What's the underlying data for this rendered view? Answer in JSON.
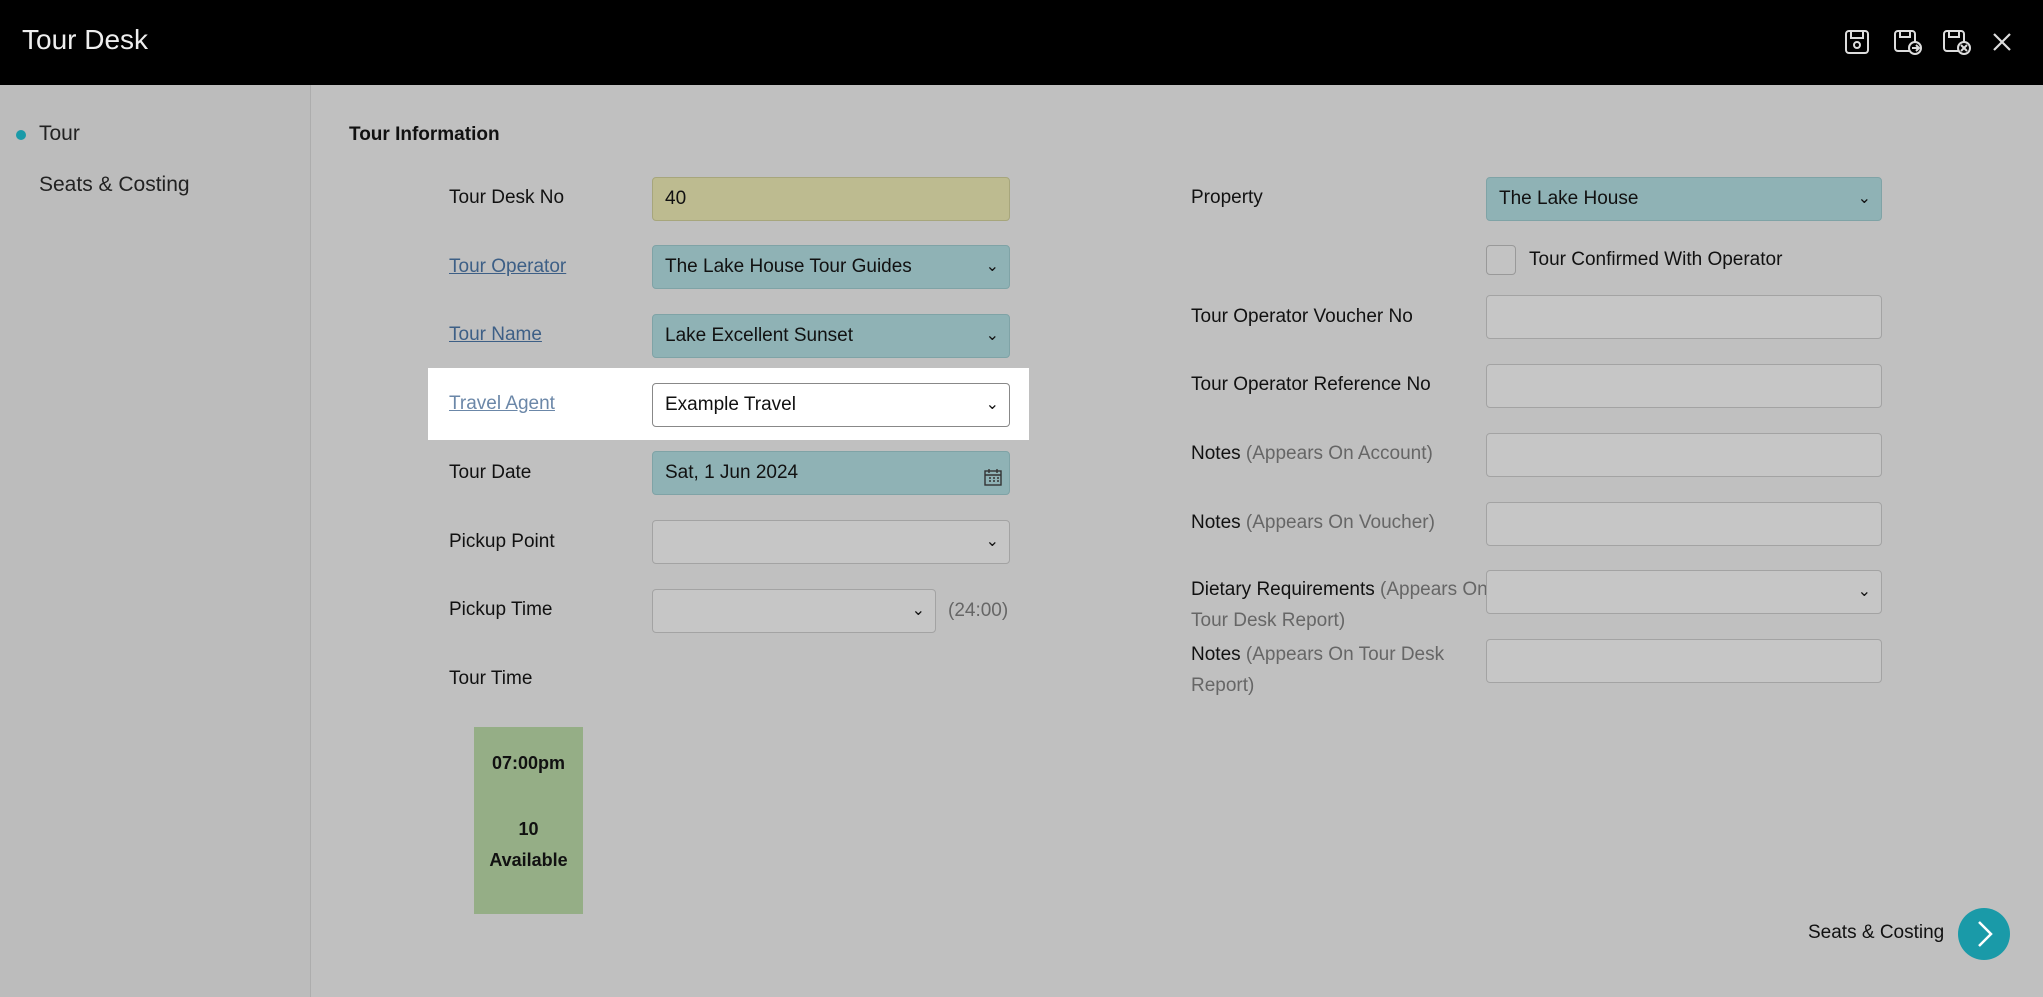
{
  "app": {
    "title": "Tour Desk"
  },
  "toolbar": {
    "icons": [
      "save-icon",
      "save-and-new-icon",
      "save-and-close-icon",
      "close-icon"
    ]
  },
  "sidebar": {
    "items": [
      {
        "label": "Tour",
        "active": true
      },
      {
        "label": "Seats & Costing",
        "active": false
      }
    ]
  },
  "section": {
    "title": "Tour Information"
  },
  "left_form": {
    "tour_desk_no": {
      "label": "Tour Desk No",
      "value": "40"
    },
    "tour_operator": {
      "label": "Tour Operator",
      "value": "The Lake House Tour Guides"
    },
    "tour_name": {
      "label": "Tour Name",
      "value": "Lake Excellent Sunset"
    },
    "travel_agent": {
      "label": "Travel Agent",
      "value": "Example Travel"
    },
    "tour_date": {
      "label": "Tour Date",
      "value": "Sat, 1 Jun 2024"
    },
    "pickup_point": {
      "label": "Pickup Point",
      "value": ""
    },
    "pickup_time": {
      "label": "Pickup Time",
      "value": "",
      "hint": "(24:00)"
    },
    "tour_time": {
      "label": "Tour Time"
    }
  },
  "tour_slot": {
    "time": "07:00pm",
    "count": "10",
    "status": "Available"
  },
  "right_form": {
    "property": {
      "label": "Property",
      "value": "The Lake House"
    },
    "confirmed": {
      "label": "Tour Confirmed With Operator",
      "checked": false
    },
    "voucher_no": {
      "label": "Tour Operator Voucher No",
      "value": ""
    },
    "reference_no": {
      "label": "Tour Operator Reference No",
      "value": ""
    },
    "notes_account": {
      "label": "Notes",
      "hint": "(Appears On Account)",
      "value": ""
    },
    "notes_voucher": {
      "label": "Notes",
      "hint": "(Appears On Voucher)",
      "value": ""
    },
    "dietary": {
      "label": "Dietary Requirements",
      "hint_line1": "(Appears On",
      "hint_line2": "Tour Desk Report)",
      "value": ""
    },
    "notes_report": {
      "label": "Notes",
      "hint_line1": "(Appears On Tour Desk",
      "hint_line2": "Report)",
      "value": ""
    }
  },
  "footer": {
    "next_label": "Seats & Costing"
  },
  "colors": {
    "accent": "#1a9aa8",
    "topbar": "#000000",
    "highlight_field": "#ffffff",
    "teal_field": "#8fb2b5",
    "readonly_field": "#bdbb90",
    "slot": "#95ae86"
  }
}
